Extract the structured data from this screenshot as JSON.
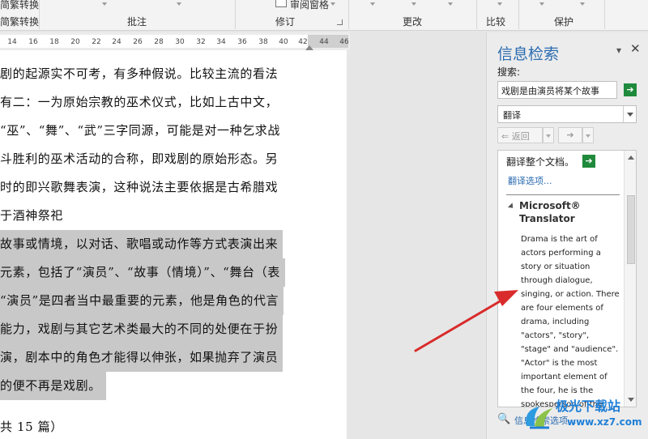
{
  "ribbon": {
    "left_top_label": "简繁转换",
    "left_label": "简繁转换",
    "review_pane_label": "审阅窗格",
    "groups": [
      "批注",
      "修订",
      "更改",
      "比较",
      "保护"
    ]
  },
  "ruler": {
    "ticks": [
      "14",
      "16",
      "18",
      "20",
      "22",
      "24",
      "26",
      "28",
      "30",
      "32",
      "34",
      "36",
      "38",
      "40",
      "42",
      "44",
      "46"
    ]
  },
  "document": {
    "lines": [
      {
        "text": "剧的起源实不可考，有多种假说。比较主流的看法",
        "selected": false
      },
      {
        "text": "有二：一为原始宗教的巫术仪式，比如上古中文，",
        "selected": false
      },
      {
        "text": "“巫”、“舞”、“武”三字同源，可能是对一种乞求战",
        "selected": false
      },
      {
        "text": "斗胜利的巫术活动的合称，即戏剧的原始形态。另",
        "selected": false
      },
      {
        "text": "时的即兴歌舞表演，这种说法主要依据是古希腊戏",
        "selected": false
      },
      {
        "text": "于酒神祭祀",
        "selected": false
      },
      {
        "text": "故事或情境，以对话、歌唱或动作等方式表演出来",
        "selected": true
      },
      {
        "text": "元素，包括了“演员”、“故事（情境）”、“舞台（表",
        "selected": true
      },
      {
        "text": "“演员”是四者当中最重要的元素，他是角色的代言",
        "selected": true
      },
      {
        "text": "能力，戏剧与其它艺术类最大的不同的处便在于扮",
        "selected": true
      },
      {
        "text": "演，剧本中的角色才能得以伸张，如果抛弃了演员",
        "selected": true
      },
      {
        "text": "的便不再是戏剧。",
        "selected": true
      },
      {
        "text": "共 15 篇）",
        "selected": false
      }
    ]
  },
  "pane": {
    "title": "信息检索",
    "controls": "▾",
    "close": "✕",
    "search_label": "搜索:",
    "search_value": "戏剧是由演员将某个故事",
    "go": "➔",
    "service": "翻译",
    "back_label": "⇐ 返回",
    "forward_label": "➔",
    "translate_doc": "翻译整个文档。",
    "translate_options": "翻译选项...",
    "ms_title": "Microsoft® Translator",
    "translation": "Drama is the art of actors performing a story or situation through dialogue, singing, or action. There are four elements of drama, including \"actors\", \"story\", \"stage\" and \"audience\". \"Actor\" is the most important element of the four, he is the spokesperson of the role, must have the",
    "research_options": "信息检索选项..."
  },
  "watermark": {
    "top": "极光下载站",
    "bottom": "www.xz7.com"
  },
  "colors": {
    "accent": "#2b6cb0",
    "go_button": "#1f8a3b",
    "selection": "#c8c8c8",
    "arrow": "#d92b2b"
  }
}
